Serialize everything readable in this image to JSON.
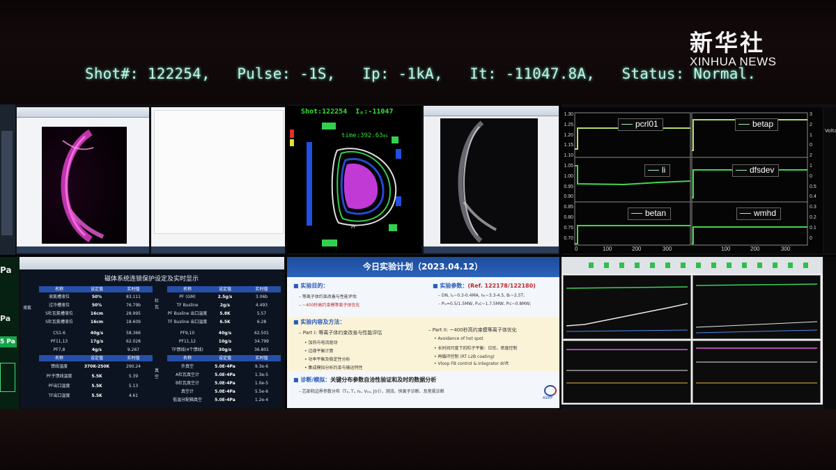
{
  "status_bar": {
    "shot": "Shot#: 122254,",
    "pulse": "Pulse: -1S,",
    "ip": "Ip: -1kA,",
    "it": "It: -11047.8A,",
    "status": "Status: Normal."
  },
  "watermark": {
    "cn": "新华社",
    "en": "XINHUA NEWS"
  },
  "left_edge": {
    "label_pa_1": "Pa",
    "label_pa_2": "Pa",
    "label_pa_3": "5 Pa",
    "label_volta": "Volta"
  },
  "tokamak": {
    "shot": "Shot:122254",
    "ip": "Iₚ:-11047",
    "time": "time:392.63",
    "unit": "ms"
  },
  "plots_top_right": {
    "labels": [
      "pcrl01",
      "betap",
      "li",
      "dfsdev",
      "betan",
      "wmhd"
    ],
    "y_ticks_left": [
      "1.30",
      "1.25",
      "1.20",
      "1.15",
      "1.10",
      "1.05",
      "1.00",
      "0.95",
      "0.90",
      "0.85",
      "0.80",
      "0.75",
      "0.70"
    ],
    "y_ticks_right": [
      "3",
      "2",
      "1",
      "0",
      "2",
      "1",
      "0",
      "0.5",
      "0.4",
      "0.3",
      "0.2",
      "0.1",
      "0"
    ],
    "x_ticks": [
      "0",
      "100",
      "200",
      "300",
      "100",
      "200",
      "300"
    ]
  },
  "interlock": {
    "title": "磁体系统连锁保护设定及实时显示",
    "headers": [
      "名称",
      "设定值",
      "实时值"
    ],
    "left_rows": [
      [
        "液氦槽液位",
        "50%",
        "83.111"
      ],
      [
        "过冷槽液位",
        "50%",
        "76.79b"
      ],
      [
        "S杜瓦氦槽液位",
        "16cm",
        "28.995"
      ],
      [
        "S杜瓦氦槽液位",
        "16cm",
        "18.609"
      ],
      [
        "CS1-6",
        "40g/s",
        "58.366"
      ],
      [
        "PF11,13",
        "17g/s",
        "62.028"
      ],
      [
        "PF7,8",
        "4g/s",
        "9.267"
      ],
      [
        "馈线温度",
        "370K-250K",
        "290.24"
      ],
      [
        "PF子馈线温度",
        "5.5K",
        "5.39"
      ],
      [
        "PF出口温度",
        "5.5K",
        "5.13"
      ],
      [
        "TF出口温度",
        "5.5K",
        "4.61"
      ]
    ],
    "right_rows": [
      [
        "PF (GM)",
        "2.5g/s",
        "3.06b"
      ],
      [
        "TF Busline",
        "2g/s",
        "4.493"
      ],
      [
        "PF Busline 出口温度",
        "5.8K",
        "5.57"
      ],
      [
        "TF Busline 出口温度",
        "6.5K",
        "6.28"
      ],
      [
        "PF9,10",
        "40g/s",
        "62.501"
      ],
      [
        "PF11,12",
        "10g/s",
        "34.799"
      ],
      [
        "TF馈线(4个馈线)",
        "30g/s",
        "36.801"
      ],
      [
        "外真空",
        "5.0E-4Pa",
        "9.3e-6"
      ],
      [
        "A杜瓦真空计",
        "5.0E-4Pa",
        "1.3e-5"
      ],
      [
        "B杜瓦真空计",
        "5.0E-4Pa",
        "1.0e-5"
      ],
      [
        "真空计",
        "5.0E-4Pa",
        "5.5e-6"
      ],
      [
        "低温分配箱真空",
        "5.0E-4Pa",
        "1.2e-4"
      ]
    ],
    "side_groups": [
      "液氦",
      "杜瓦",
      "真空"
    ]
  },
  "plan": {
    "title": "今日实验计划（2023.04.12）",
    "purpose_title": "实验目的：",
    "purpose_items": [
      "等离子体约束改善与性能评估",
      "~400秒高约束模等离子体优化"
    ],
    "params_title": "实验参数：",
    "params_ref": "(Ref. 122178/122180)",
    "params_items": [
      "DN, Iₚ~0.3-0.4MA, nₑ~3.3-4.5, Bₜ~2.5T;",
      "Pₗₕ=0.5/1.5MW, Pₑc~1.7.5MW, Pₗc~0.8MW;"
    ],
    "content_title": "实验内容及方法：",
    "part1_title": "Part I: 等离子体约束改善与性能评估",
    "part1_items": [
      "加热与电流驱动",
      "边缘平衡计算",
      "功率平衡及稳定性分析",
      "集成模拟分析约束与输运特性"
    ],
    "part2_title": "Part II: ~400秒高约束模等离子体优化",
    "part2_items": [
      "Avoidance of hot spot",
      "长时间尺度下的粒子平衡：位形、密度控制",
      "再循环控制 (RT Li/B coating)",
      "Vloop FB control & integrator drift"
    ],
    "diag_title": "诊断/模拟：",
    "diag_text": "关键分布参数自洽性验证和及时的数据分析",
    "diag_item": "芯部和边界参数分布（Tₑ, Tᵢ, nₑ, Vₜₒₗ, J(r)），测流、快离子诊断、及常规诊断",
    "logo": "ASIPP"
  }
}
